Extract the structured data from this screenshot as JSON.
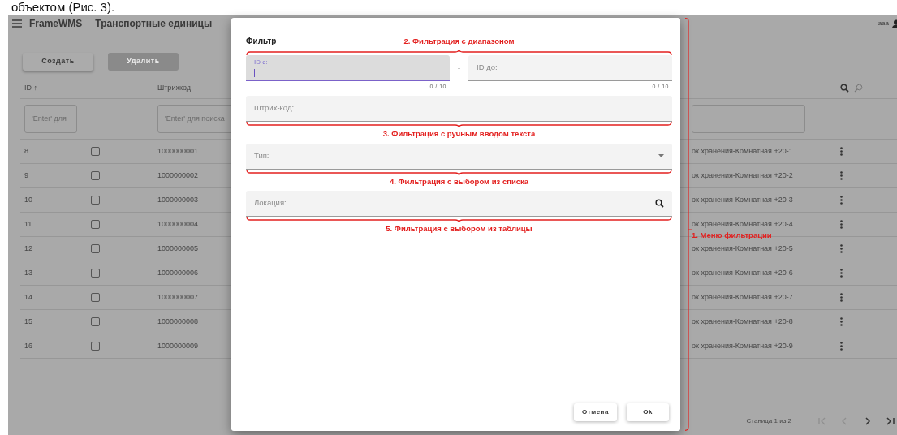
{
  "document_text": "объектом (Рис. 3).",
  "app": {
    "brand": "FrameWMS",
    "page_title": "Транспортные единицы",
    "user": "aaa"
  },
  "toolbar": [
    {
      "label": "Создать",
      "disabled": false
    },
    {
      "label": "Удалить",
      "disabled": true
    }
  ],
  "table": {
    "id_column": "ID ↑",
    "barcode_column": "Штрихкод",
    "id_filter_placeholder": "'Enter' для",
    "barcode_filter_placeholder": "'Enter' для поиска",
    "rows": [
      {
        "id": "8",
        "checked": false,
        "barcode": "1000000001",
        "location": "ок хранения-Комнатная +20-1"
      },
      {
        "id": "9",
        "checked": false,
        "barcode": "1000000002",
        "location": "ок хранения-Комнатная +20-2"
      },
      {
        "id": "10",
        "checked": false,
        "barcode": "1000000003",
        "location": "ок хранения-Комнатная +20-3"
      },
      {
        "id": "11",
        "checked": false,
        "barcode": "1000000004",
        "location": "ок хранения-Комнатная +20-4"
      },
      {
        "id": "12",
        "checked": false,
        "barcode": "1000000005",
        "location": "ок хранения-Комнатная +20-5"
      },
      {
        "id": "13",
        "checked": false,
        "barcode": "1000000006",
        "location": "ок хранения-Комнатная +20-6"
      },
      {
        "id": "14",
        "checked": false,
        "barcode": "1000000007",
        "location": "ок хранения-Комнатная +20-7"
      },
      {
        "id": "15",
        "checked": false,
        "barcode": "1000000008",
        "location": "ок хранения-Комнатная +20-8"
      },
      {
        "id": "16",
        "checked": false,
        "barcode": "1000000009",
        "location": "ок хранения-Комнатная +20-9"
      }
    ]
  },
  "pagination": {
    "label": "Станица 1 из 2",
    "buttons": [
      {
        "kind": "first",
        "disabled": true
      },
      {
        "kind": "previous",
        "disabled": true
      },
      {
        "kind": "next",
        "disabled": false
      },
      {
        "kind": "last",
        "disabled": false
      }
    ]
  },
  "dialog": {
    "title": "Фильтр",
    "annotation": "1. Меню фильтрации",
    "fields": [
      {
        "kind": "range",
        "annotation_above": "2. Фильтрация с диапазоном",
        "from": {
          "label": "ID с:",
          "focused": true,
          "counter": "0 / 10"
        },
        "separator": "-",
        "to": {
          "label": "ID до:",
          "focused": false,
          "counter": "0 / 10"
        }
      },
      {
        "kind": "text",
        "placeholder": "Штрих-код:",
        "annotation_below": "3. Фильтрация с ручным вводом текста"
      },
      {
        "kind": "select",
        "placeholder": "Тип:",
        "annotation_below": "4. Фильтрация с выбором из списка"
      },
      {
        "kind": "lookup",
        "placeholder": "Локация:",
        "annotation_below": "5. Фильтрация с выбором из таблицы"
      }
    ],
    "buttons": [
      "Отмена",
      "Ok"
    ]
  }
}
